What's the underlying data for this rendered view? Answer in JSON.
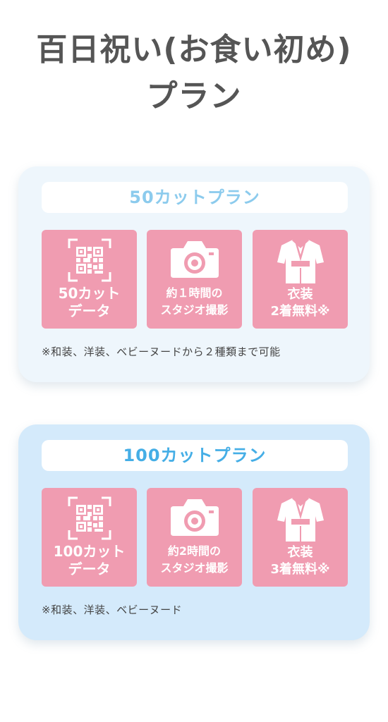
{
  "page": {
    "title_line1": "百日祝い(お食い初め)",
    "title_line2": "プラン"
  },
  "colors": {
    "tile_pink": "#f09cb1",
    "card1_bg": "#eef6fc",
    "card2_bg": "#d4eafb",
    "header1_text": "#8ccbed",
    "header2_text": "#45aee6",
    "title_text": "#555555"
  },
  "plans": [
    {
      "name": "50カットプラン",
      "features": [
        {
          "icon": "qr-code-icon",
          "line1": "50カット",
          "line2": "データ"
        },
        {
          "icon": "camera-icon",
          "line1": "約１時間の",
          "line2": "スタジオ撮影"
        },
        {
          "icon": "kimono-icon",
          "line1": "衣装",
          "line2": "2着無料※"
        }
      ],
      "note": "※和装、洋装、ベビーヌードから２種類まで可能"
    },
    {
      "name": "100カットプラン",
      "features": [
        {
          "icon": "qr-code-icon",
          "line1": "100カット",
          "line2": "データ"
        },
        {
          "icon": "camera-icon",
          "line1": "約2時間の",
          "line2": "スタジオ撮影"
        },
        {
          "icon": "kimono-icon",
          "line1": "衣装",
          "line2": "3着無料※"
        }
      ],
      "note": "※和装、洋装、ベビーヌード"
    }
  ]
}
